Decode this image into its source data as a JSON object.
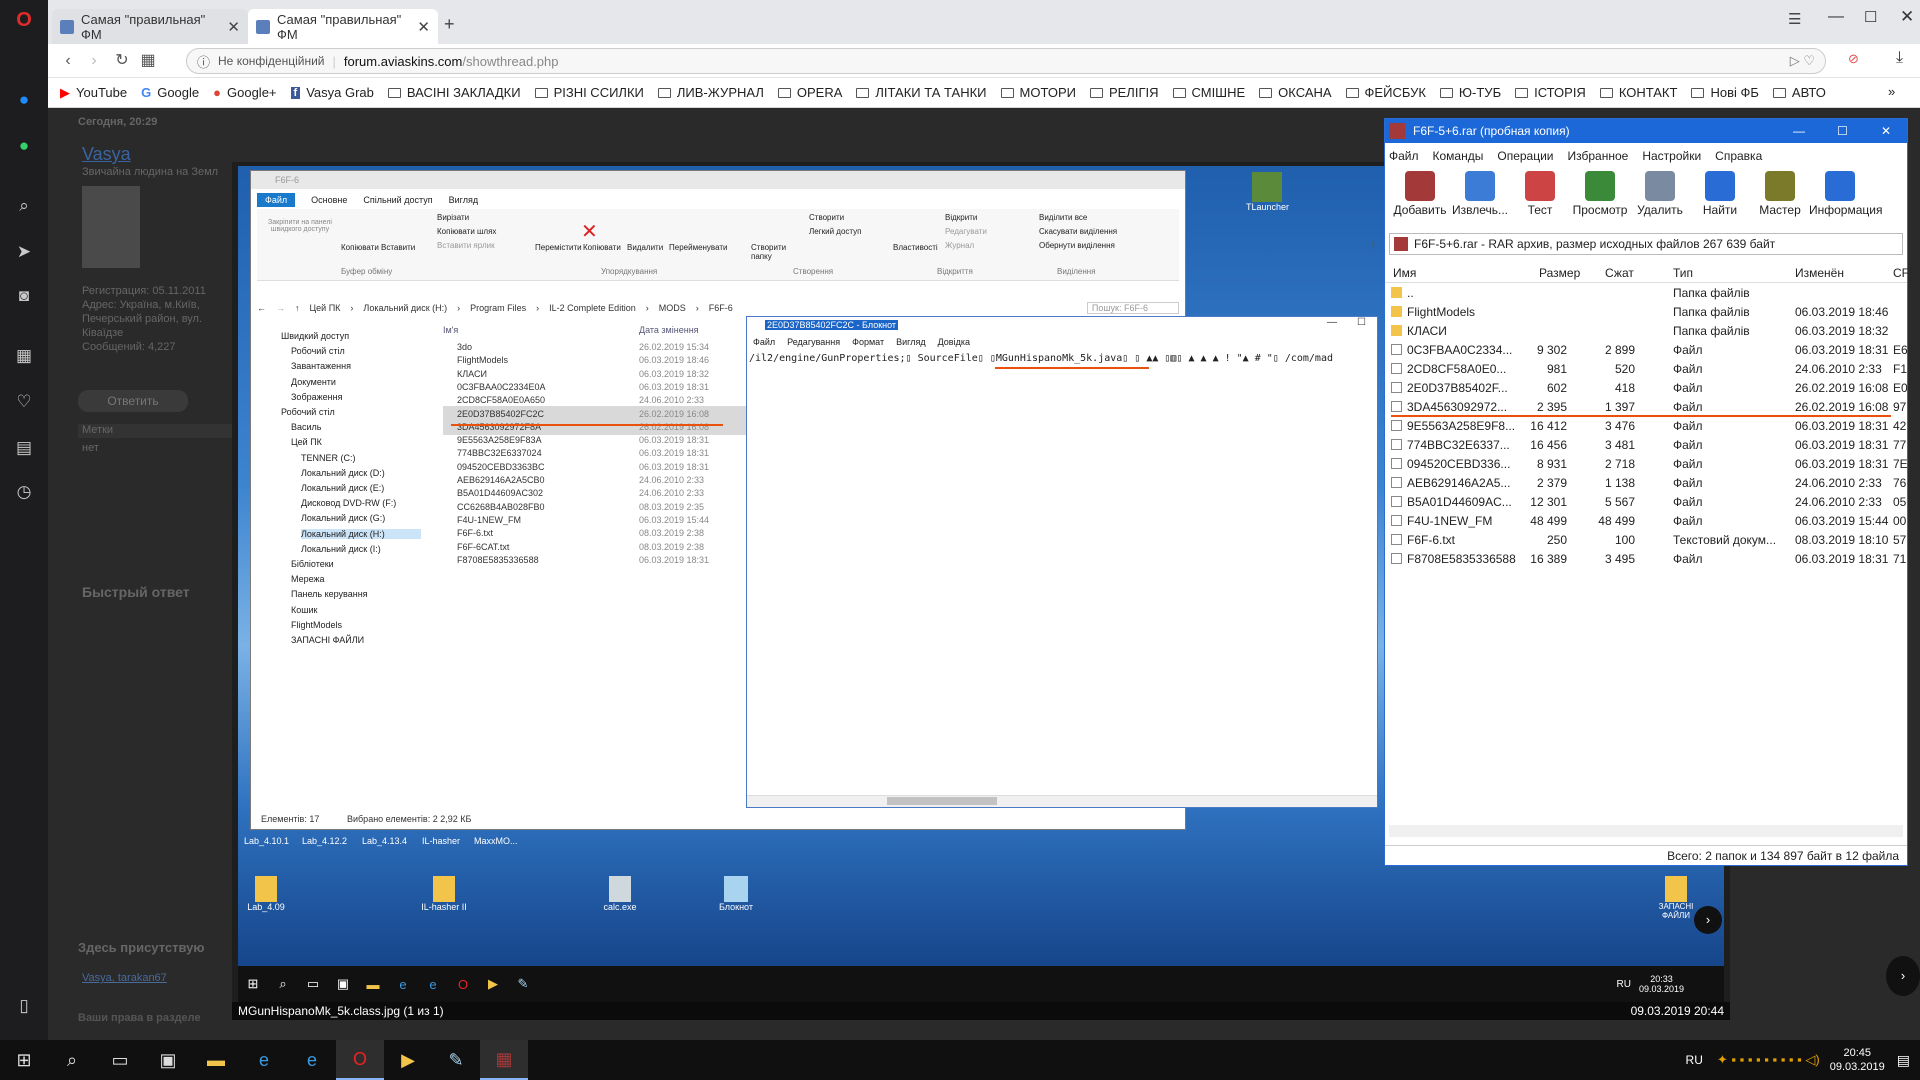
{
  "browser": {
    "tabs": [
      {
        "label": "Самая \"правильная\" ФМ"
      },
      {
        "label": "Самая \"правильная\" ФМ"
      }
    ],
    "security_label": "Не конфіденційний",
    "url_domain": "forum.aviaskins.com",
    "url_path": "/showthread.php",
    "bookmarks": [
      "YouTube",
      "Google",
      "Google+",
      "Vasya Grab",
      "ВАСІНІ ЗАКЛАДКИ",
      "РІЗНІ ССИЛКИ",
      "ЛИВ-ЖУРНАЛ",
      "OPERA",
      "ЛІТАКИ ТА ТАНКИ",
      "МОТОРИ",
      "РЕЛІГІЯ",
      "СМІШНЕ",
      "ОКСАНА",
      "ФЕЙСБУК",
      "Ю-ТУБ",
      "ІСТОРІЯ",
      "КОНТАКТ",
      "Нові ФБ",
      "АВТО"
    ],
    "more_bookmarks": "»"
  },
  "forum": {
    "post_date": "Сегодня, 20:29",
    "username": "Vasya",
    "user_title": "Звичайна людина на Земл",
    "reg": "Регистрация: 05.11.2011",
    "address": "Адрес: Україна, м.Київ, Печерський район, вул. Ківаїдзе",
    "messages": "Сообщений: 4,227",
    "reply_btn": "Ответить",
    "tags_label": "Метки",
    "tags_value": "нет",
    "quick_reply": "Быстрый ответ",
    "present": "Здесь присутствую",
    "present_users": "Vasya, tarakan67",
    "rights": "Ваши права в разделе"
  },
  "viewer": {
    "filename": "MGunHispanoMk_5k.class.jpg (1 из 1)",
    "datetime": "09.03.2019 20:44"
  },
  "explorer": {
    "title": "F6F-6",
    "ribbon_tabs": [
      "Файл",
      "Основне",
      "Спільний доступ",
      "Вигляд"
    ],
    "ribbon_groups": [
      "Буфер обміну",
      "Упорядкування",
      "Створення",
      "Відкриття",
      "Виділення"
    ],
    "ribbon_items": [
      "Закріпити на панелі швидкого доступу",
      "Копіювати",
      "Вставити",
      "Вирізати",
      "Копіювати шлях",
      "Вставити ярлик",
      "Перемістити",
      "Копіювати",
      "Видалити",
      "Перейменувати",
      "Створити папку",
      "Створити",
      "Легкий доступ",
      "Властивості",
      "Відкрити",
      "Редагувати",
      "Журнал",
      "Виділити все",
      "Скасувати виділення",
      "Обернути виділення"
    ],
    "path": [
      "Цей ПК",
      "Локальний диск (H:)",
      "Program Files",
      "IL-2 Complete Edition",
      "MODS",
      "F6F-6"
    ],
    "search_placeholder": "Пошук: F6F-6",
    "col_name": "Ім'я",
    "col_date": "Дата змінення",
    "col_type": "Ти",
    "nav": [
      "Швидкий доступ",
      "Робочий стіл",
      "Завантаження",
      "Документи",
      "Зображення",
      "Робочий стіл",
      "Василь",
      "Цей ПК",
      "TENNER (C:)",
      "Локальний диск (D:)",
      "Локальний диск (E:)",
      "Дисковод DVD-RW (F:)",
      "Локальний диск (G:)",
      "Локальний диск (H:)",
      "Локальний диск (I:)",
      "Бібліотеки",
      "Мережа",
      "Панель керування",
      "Кошик",
      "FlightModels",
      "ЗАПАСНІ ФАЙЛИ"
    ],
    "files": [
      {
        "name": "3do",
        "date": "26.02.2019 15:34",
        "type": "Па"
      },
      {
        "name": "FlightModels",
        "date": "06.03.2019 18:46",
        "type": "Па"
      },
      {
        "name": "КЛАСИ",
        "date": "06.03.2019 18:32",
        "type": "Па"
      },
      {
        "name": "0C3FBAA0C2334E0A",
        "date": "06.03.2019 18:31",
        "type": "Фа"
      },
      {
        "name": "2CD8CF58A0E0A650",
        "date": "24.06.2010 2:33",
        "type": "Фа"
      },
      {
        "name": "2E0D37B85402FC2C",
        "date": "26.02.2019 16:08",
        "type": "Фа"
      },
      {
        "name": "3DA4563092972F8A",
        "date": "26.02.2019 16:08",
        "type": "Фа"
      },
      {
        "name": "9E5563A258E9F83A",
        "date": "06.03.2019 18:31",
        "type": "Фа"
      },
      {
        "name": "774BBC32E6337024",
        "date": "06.03.2019 18:31",
        "type": "Фа"
      },
      {
        "name": "094520CEBD3363BC",
        "date": "06.03.2019 18:31",
        "type": "Фа"
      },
      {
        "name": "AEB629146A2A5CB0",
        "date": "24.06.2010 2:33",
        "type": "Фа"
      },
      {
        "name": "B5A01D44609AC302",
        "date": "24.06.2010 2:33",
        "type": "Фа"
      },
      {
        "name": "CC6268B4AB028FB0",
        "date": "08.03.2019 2:35",
        "type": "Фа"
      },
      {
        "name": "F4U-1NEW_FM",
        "date": "06.03.2019 15:44",
        "type": "Фа"
      },
      {
        "name": "F6F-6.txt",
        "date": "08.03.2019 2:38",
        "type": "Те"
      },
      {
        "name": "F6F-6CAT.txt",
        "date": "08.03.2019 2:38",
        "type": "Те"
      },
      {
        "name": "F8708E5835336588",
        "date": "06.03.2019 18:31",
        "type": "Фа"
      }
    ],
    "status_count": "Елементів: 17",
    "status_selected": "Вибрано елементів: 2  2,92 КБ"
  },
  "notepad": {
    "title": "2E0D37B85402FC2C - Блокнот",
    "menu": [
      "Файл",
      "Редагування",
      "Формат",
      "Вигляд",
      "Довідка"
    ],
    "content": "/il2/engine/GunProperties;▯ SourceFile▯ ▯MGunHispanoMk_5k.java▯ ▯ ▲▲ ▯▥▯ ▲ ▲   ▲ ! \"▲ # \"▯ /com/mad"
  },
  "winrar": {
    "title": "F6F-5+6.rar (пробная копия)",
    "menu": [
      "Файл",
      "Команды",
      "Операции",
      "Избранное",
      "Настройки",
      "Справка"
    ],
    "toolbar": [
      "Добавить",
      "Извлечь...",
      "Тест",
      "Просмотр",
      "Удалить",
      "Найти",
      "Мастер",
      "Информация"
    ],
    "path": "F6F-5+6.rar - RAR архив, размер исходных файлов 267 639 байт",
    "columns": [
      "Имя",
      "Размер",
      "Сжат",
      "Тип",
      "Изменён",
      "CF"
    ],
    "rows": [
      {
        "name": "..",
        "size": "",
        "packed": "",
        "type": "Папка файлів",
        "mod": "",
        "crc": ""
      },
      {
        "name": "FlightModels",
        "size": "",
        "packed": "",
        "type": "Папка файлів",
        "mod": "06.03.2019 18:46",
        "crc": ""
      },
      {
        "name": "КЛАСИ",
        "size": "",
        "packed": "",
        "type": "Папка файлів",
        "mod": "06.03.2019 18:32",
        "crc": ""
      },
      {
        "name": "0C3FBAA0C2334...",
        "size": "9 302",
        "packed": "2 899",
        "type": "Файл",
        "mod": "06.03.2019 18:31",
        "crc": "E6"
      },
      {
        "name": "2CD8CF58A0E0...",
        "size": "981",
        "packed": "520",
        "type": "Файл",
        "mod": "24.06.2010 2:33",
        "crc": "F1"
      },
      {
        "name": "2E0D37B85402F...",
        "size": "602",
        "packed": "418",
        "type": "Файл",
        "mod": "26.02.2019 16:08",
        "crc": "E0"
      },
      {
        "name": "3DA4563092972...",
        "size": "2 395",
        "packed": "1 397",
        "type": "Файл",
        "mod": "26.02.2019 16:08",
        "crc": "97"
      },
      {
        "name": "9E5563A258E9F8...",
        "size": "16 412",
        "packed": "3 476",
        "type": "Файл",
        "mod": "06.03.2019 18:31",
        "crc": "42"
      },
      {
        "name": "774BBC32E6337...",
        "size": "16 456",
        "packed": "3 481",
        "type": "Файл",
        "mod": "06.03.2019 18:31",
        "crc": "77"
      },
      {
        "name": "094520CEBD336...",
        "size": "8 931",
        "packed": "2 718",
        "type": "Файл",
        "mod": "06.03.2019 18:31",
        "crc": "7E"
      },
      {
        "name": "AEB629146A2A5...",
        "size": "2 379",
        "packed": "1 138",
        "type": "Файл",
        "mod": "24.06.2010 2:33",
        "crc": "76"
      },
      {
        "name": "B5A01D44609AC...",
        "size": "12 301",
        "packed": "5 567",
        "type": "Файл",
        "mod": "24.06.2010 2:33",
        "crc": "05"
      },
      {
        "name": "F4U-1NEW_FM",
        "size": "48 499",
        "packed": "48 499",
        "type": "Файл",
        "mod": "06.03.2019 15:44",
        "crc": "00"
      },
      {
        "name": "F6F-6.txt",
        "size": "250",
        "packed": "100",
        "type": "Текстовий докум...",
        "mod": "08.03.2019 18:10",
        "crc": "57"
      },
      {
        "name": "F8708E5835336588",
        "size": "16 389",
        "packed": "3 495",
        "type": "Файл",
        "mod": "06.03.2019 18:31",
        "crc": "71"
      }
    ],
    "status": "Всего: 2 папок и 134 897 байт в 12 файла"
  },
  "desktop_icons": [
    "TLauncher",
    "Lab_4.10.1",
    "Lab_4.12.2",
    "Lab_4.13.4",
    "IL-hasher",
    "MaxxMO...",
    "Lab_4.09",
    "IL-hasher II",
    "calc.exe",
    "Блокнот",
    "ЗАПАСНІ ФАЙЛИ"
  ],
  "inner_tray": {
    "lang": "RU",
    "time": "20:33",
    "date": "09.03.2019"
  },
  "tray": {
    "lang": "RU",
    "time": "20:45",
    "date": "09.03.2019"
  },
  "colors": {
    "accent": "#2a6cd6",
    "underline": "#e8520c"
  }
}
